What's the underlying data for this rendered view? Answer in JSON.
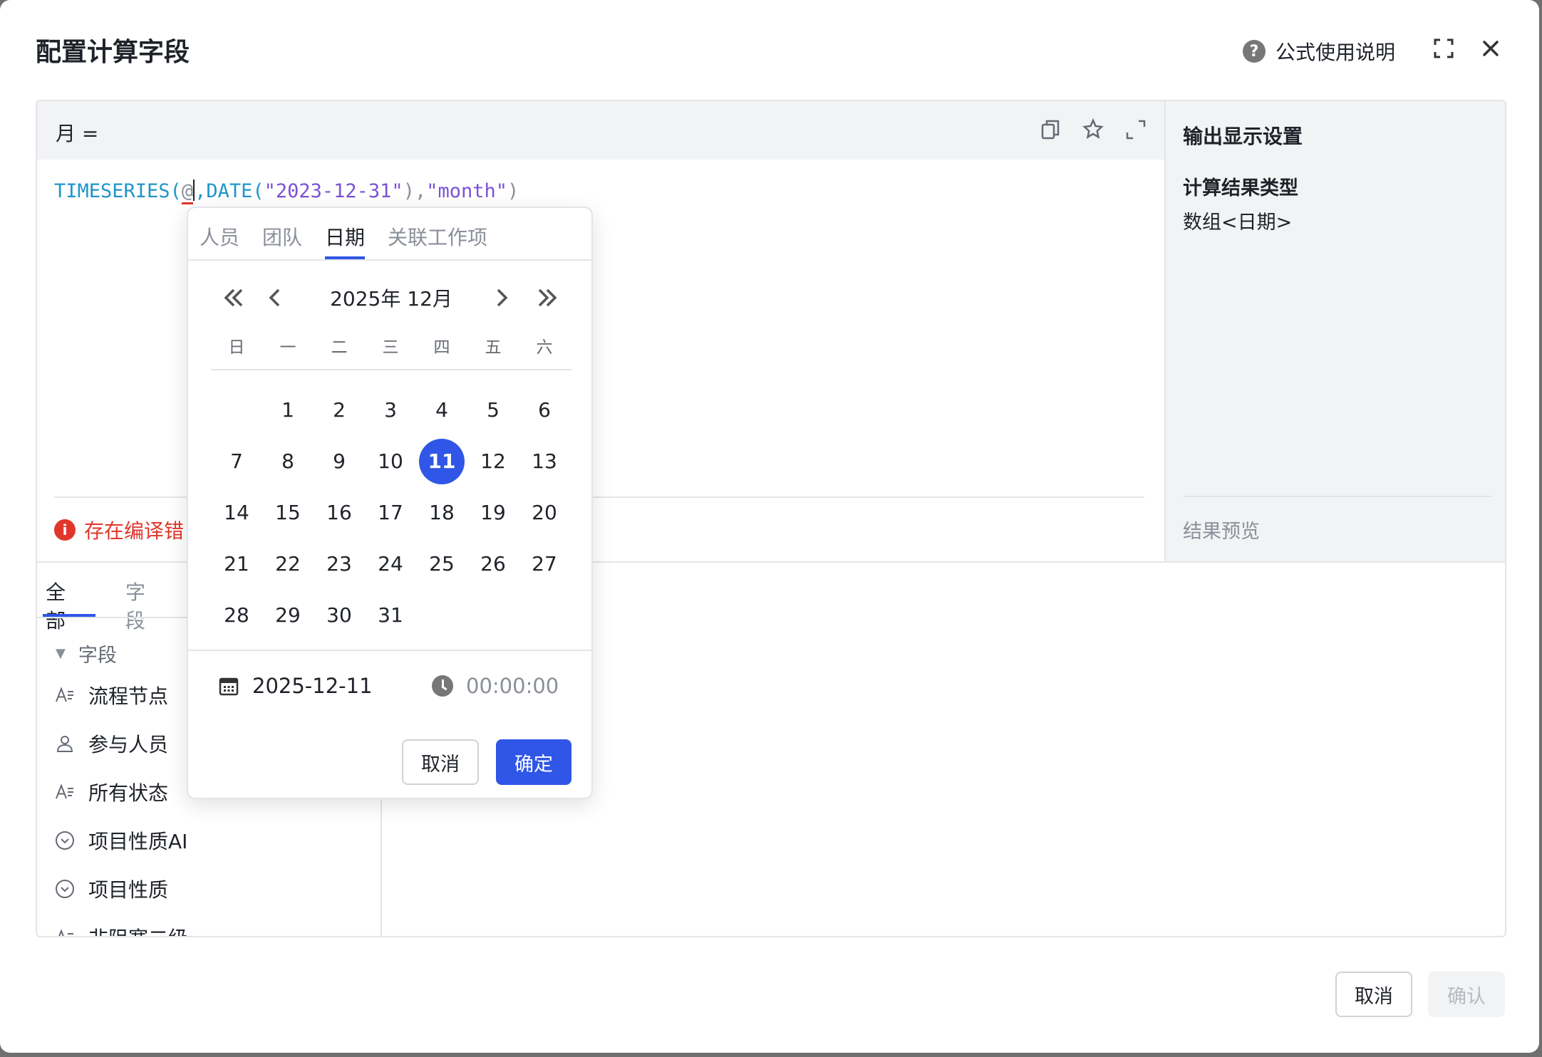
{
  "dialog": {
    "title": "配置计算字段",
    "help_label": "公式使用说明",
    "cancel_label": "取消",
    "confirm_label": "确认"
  },
  "editor": {
    "field_name": "月 =",
    "code_fn": "TIMESERIES(",
    "code_at": "@",
    "code_rest_fn": ",DATE(",
    "code_str1": "\"2023-12-31\"",
    "code_mid": "),",
    "code_str2": "\"month\"",
    "code_end": ")",
    "error_text": "存在编译错"
  },
  "output": {
    "title": "输出显示设置",
    "result_type_label": "计算结果类型",
    "result_type_value": "数组<日期>",
    "preview_label": "结果预览"
  },
  "library": {
    "tabs": [
      "全部",
      "字段"
    ],
    "group_label": "字段",
    "items": [
      {
        "label": "流程节点",
        "icon": "text-field-icon"
      },
      {
        "label": "参与人员",
        "icon": "person-icon"
      },
      {
        "label": "所有状态",
        "icon": "text-field-icon"
      },
      {
        "label": "项目性质AI",
        "icon": "select-icon"
      },
      {
        "label": "项目性质",
        "icon": "select-icon"
      },
      {
        "label": "非阻塞二级",
        "icon": "text-field-icon"
      }
    ]
  },
  "picker": {
    "tabs": [
      "人员",
      "团队",
      "日期",
      "关联工作项"
    ],
    "active_tab": "日期",
    "month_label": "2025年 12月",
    "weekdays": [
      "日",
      "一",
      "二",
      "三",
      "四",
      "五",
      "六"
    ],
    "days": [
      "1",
      "2",
      "3",
      "4",
      "5",
      "6",
      "7",
      "8",
      "9",
      "10",
      "11",
      "12",
      "13",
      "14",
      "15",
      "16",
      "17",
      "18",
      "19",
      "20",
      "21",
      "22",
      "23",
      "24",
      "25",
      "26",
      "27",
      "28",
      "29",
      "30",
      "31"
    ],
    "selected_day": "11",
    "date_value": "2025-12-11",
    "time_value": "00:00:00",
    "cancel_label": "取消",
    "ok_label": "确定"
  },
  "colors": {
    "accent": "#2f56e6",
    "error": "#e1362c",
    "code_keyword": "#1f95c9",
    "code_string": "#7b52d6"
  }
}
